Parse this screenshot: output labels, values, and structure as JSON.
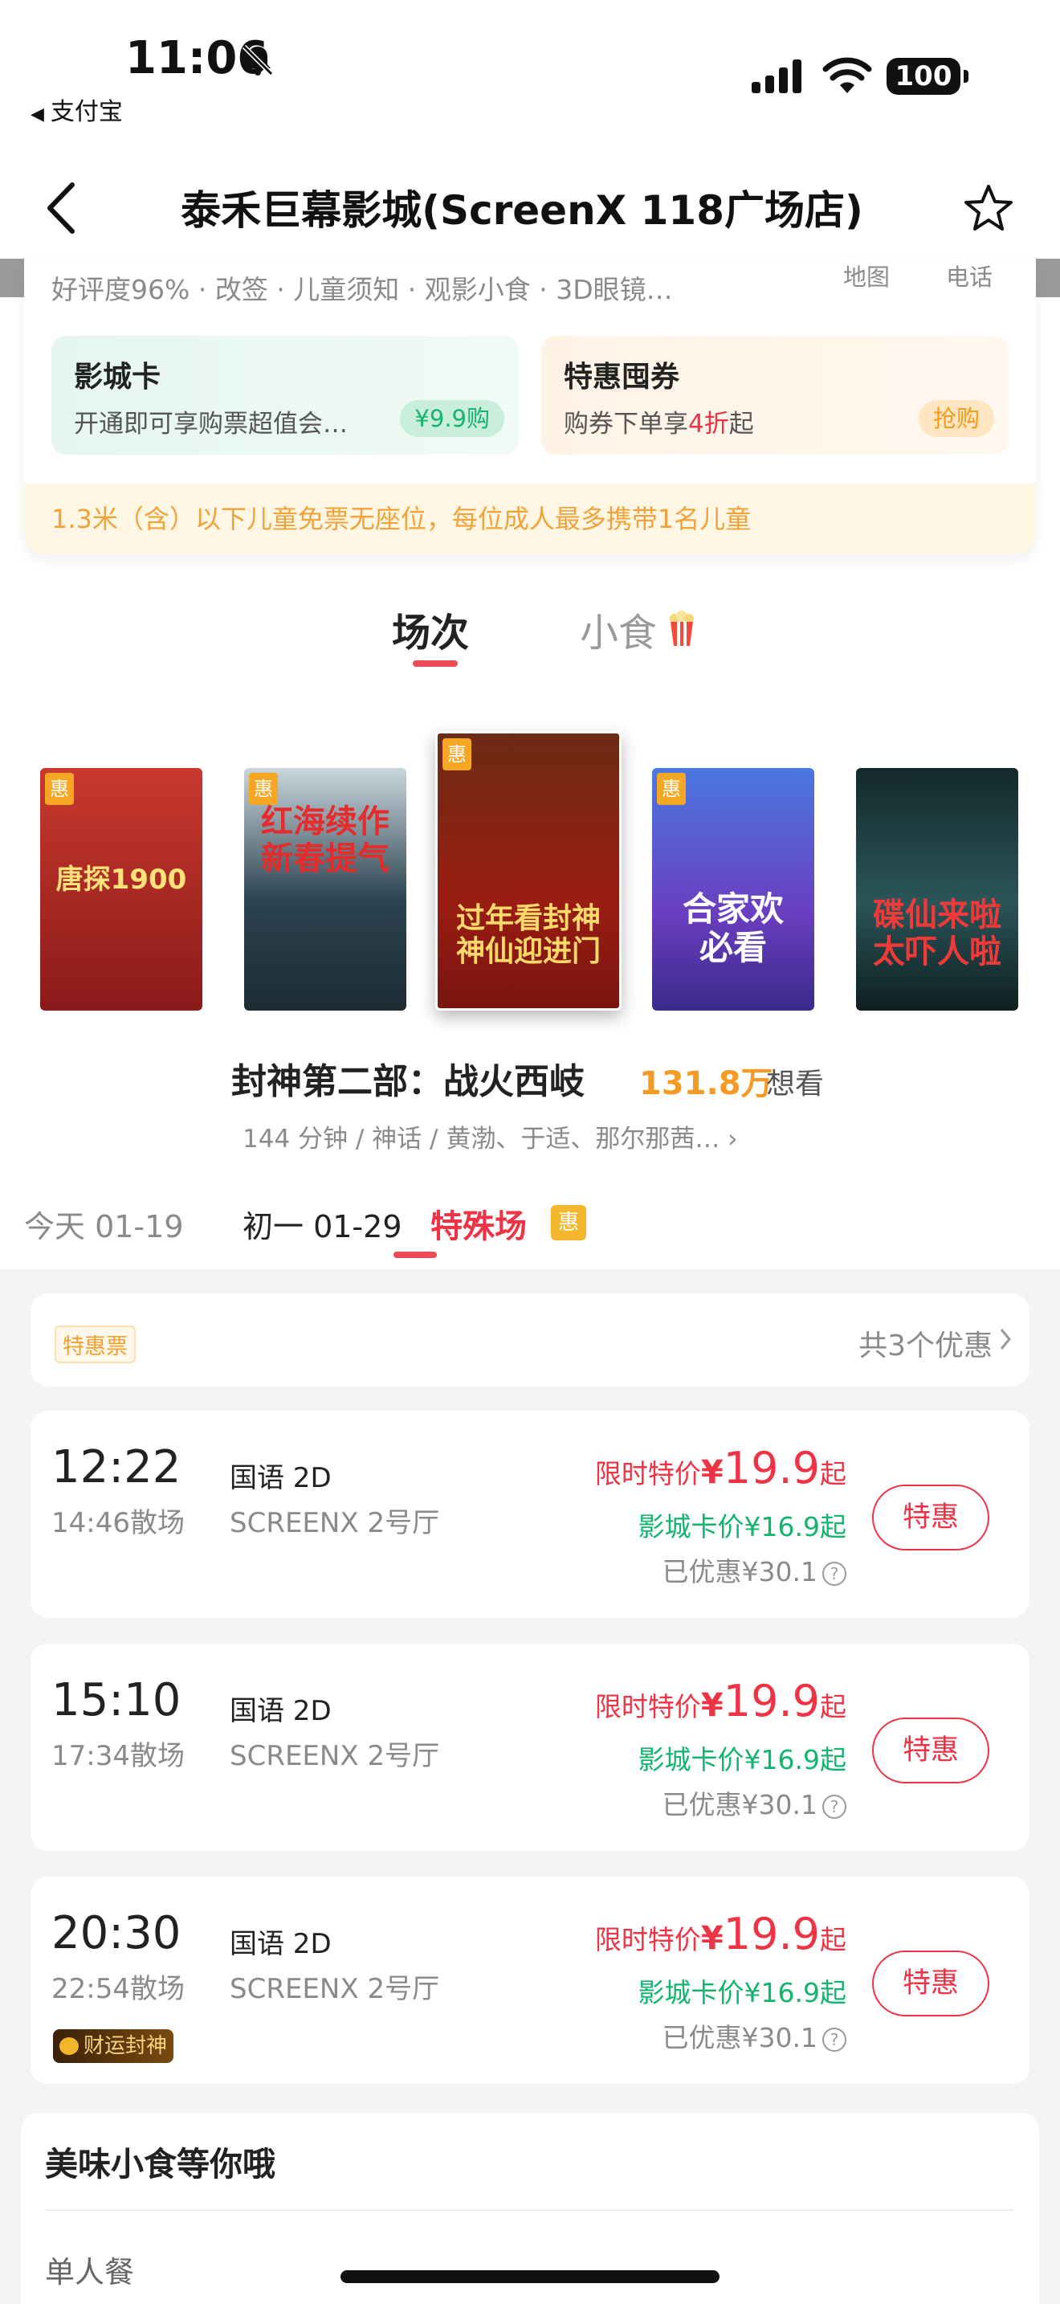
{
  "status_bar": {
    "time": "11:06",
    "back_app": "支付宝",
    "battery": "100"
  },
  "nav": {
    "title": "泰禾巨幕影城(ScreenX 118广场店)"
  },
  "cinema": {
    "tags": "好评度96% · 改签 · 儿童须知 · 观影小食 · 3D眼镜…",
    "map_label": "地图",
    "phone_label": "电话",
    "promo_card": {
      "title": "影城卡",
      "desc": "开通即可享购票超值会…",
      "badge": "¥9.9购"
    },
    "promo_coupon": {
      "title": "特惠囤券",
      "desc_prefix": "购券下单享",
      "desc_highlight": "4折",
      "desc_suffix": "起",
      "badge": "抢购"
    },
    "notice": "1.3米（含）以下儿童免票无座位，每位成人最多携带1名儿童"
  },
  "tabs": {
    "sessions": "场次",
    "snacks": "小食"
  },
  "posters": [
    {
      "hui": "惠",
      "text": "唐探1900",
      "bg": "#b5282c"
    },
    {
      "hui": "惠",
      "text": "红海续作\n新春提气",
      "bg": "#30444f"
    },
    {
      "hui": "惠",
      "text": "过年看封神\n神仙迎进门",
      "bg": "#8e1b13"
    },
    {
      "hui": "惠",
      "text": "合家欢\n必看",
      "bg": "#3e3aa8"
    },
    {
      "hui": "",
      "text": "碟仙来啦\n太吓人啦",
      "bg": "#1f3d3f"
    }
  ],
  "movie": {
    "title": "封神第二部：战火西岐",
    "want_count": "131.8万",
    "want_label": "想看",
    "info": "144 分钟 / 神话 / 黄渤、于适、那尔那茜… ›"
  },
  "dates": {
    "today": "今天 01-19",
    "special_day": "初一 01-29",
    "special_label": "特殊场",
    "hui": "惠"
  },
  "coupon_bar": {
    "tag": "特惠票",
    "count": "共3个优惠"
  },
  "showtimes": [
    {
      "start": "12:22",
      "end": "14:46散场",
      "lang": "国语 2D",
      "hall": "SCREENX 2号厅",
      "price_label": "限时特价",
      "currency": "¥",
      "price": "19.9",
      "qi": "起",
      "card_price": "影城卡价¥16.9起",
      "saved": "已优惠¥30.1",
      "button": "特惠",
      "badge": ""
    },
    {
      "start": "15:10",
      "end": "17:34散场",
      "lang": "国语 2D",
      "hall": "SCREENX 2号厅",
      "price_label": "限时特价",
      "currency": "¥",
      "price": "19.9",
      "qi": "起",
      "card_price": "影城卡价¥16.9起",
      "saved": "已优惠¥30.1",
      "button": "特惠",
      "badge": ""
    },
    {
      "start": "20:30",
      "end": "22:54散场",
      "lang": "国语 2D",
      "hall": "SCREENX 2号厅",
      "price_label": "限时特价",
      "currency": "¥",
      "price": "19.9",
      "qi": "起",
      "card_price": "影城卡价¥16.9起",
      "saved": "已优惠¥30.1",
      "button": "特惠",
      "badge": "财运封神"
    }
  ],
  "snacks": {
    "title": "美味小食等你哦",
    "category": "单人餐"
  },
  "colors": {
    "accent_red": "#ee3344",
    "green": "#12b56d",
    "orange": "#f59a23"
  },
  "icons": [
    "bell-mute-icon",
    "signal-icon",
    "wifi-icon",
    "back-arrow-icon",
    "star-icon",
    "popcorn-icon",
    "chevron-right-icon",
    "help-icon"
  ]
}
